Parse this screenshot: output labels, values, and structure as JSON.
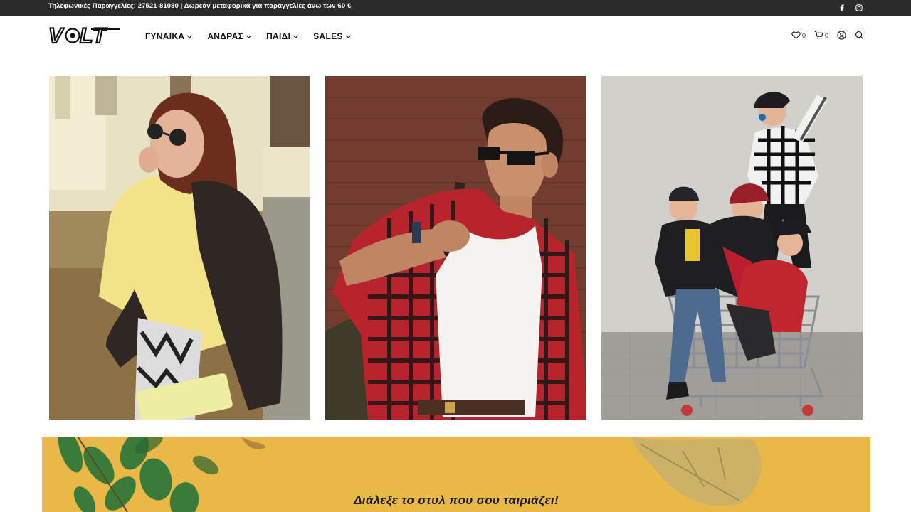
{
  "topbar": {
    "message": "Τηλεφωνικές Παραγγελίες: 27521-81080 | Δωρεάν μεταφορικά για παραγγελίες άνω των 60 €",
    "social_icons": [
      "facebook-icon",
      "instagram-icon"
    ]
  },
  "header": {
    "logo_text": "VOLT",
    "nav": [
      {
        "label": "ΓΥΝΑΙΚΑ"
      },
      {
        "label": "ΑΝΔΡΑΣ"
      },
      {
        "label": "ΠΑΙΔΙ"
      },
      {
        "label": "SALES"
      }
    ],
    "wishlist_count": "0",
    "cart_count": "0"
  },
  "tiles": [
    {
      "subject": "woman",
      "icon": "photo-woman"
    },
    {
      "subject": "man",
      "icon": "photo-man"
    },
    {
      "subject": "kids",
      "icon": "photo-kids"
    }
  ],
  "banner": {
    "headline": "Διάλεξε το στυλ που σου ταιριάζει!",
    "background_color": "#e9b846"
  },
  "colors": {
    "topbar_bg": "#2b2b2b",
    "banner_bg": "#e9b846"
  }
}
